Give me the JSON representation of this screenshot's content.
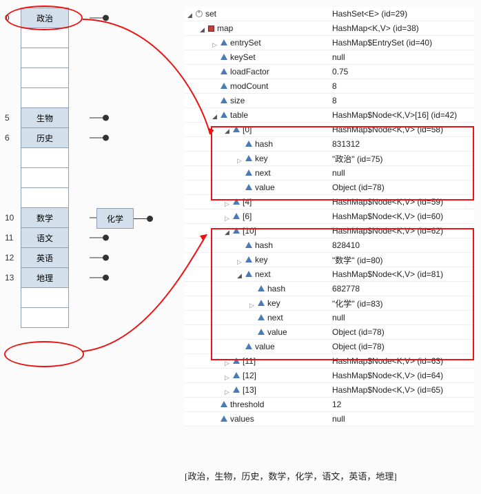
{
  "array": {
    "slots": [
      {
        "idx": "0",
        "label": "政治",
        "filled": true,
        "term": true
      },
      {
        "idx": "",
        "label": "",
        "filled": false
      },
      {
        "idx": "",
        "label": "",
        "filled": false
      },
      {
        "idx": "",
        "label": "",
        "filled": false
      },
      {
        "idx": "",
        "label": "",
        "filled": false
      },
      {
        "idx": "5",
        "label": "生物",
        "filled": true,
        "term": true
      },
      {
        "idx": "6",
        "label": "历史",
        "filled": true,
        "term": true
      },
      {
        "idx": "",
        "label": "",
        "filled": false
      },
      {
        "idx": "",
        "label": "",
        "filled": false
      },
      {
        "idx": "",
        "label": "",
        "filled": false
      },
      {
        "idx": "10",
        "label": "数学",
        "filled": true,
        "arrow": true,
        "chain": "化学"
      },
      {
        "idx": "11",
        "label": "语文",
        "filled": true,
        "term": true
      },
      {
        "idx": "12",
        "label": "英语",
        "filled": true,
        "term": true
      },
      {
        "idx": "13",
        "label": "地理",
        "filled": true,
        "term": true
      },
      {
        "idx": "",
        "label": "",
        "filled": false
      },
      {
        "idx": "",
        "label": "",
        "filled": false
      }
    ]
  },
  "tree": [
    {
      "d": 0,
      "tw": "exp",
      "ic": "circ",
      "n": "set",
      "v": "HashSet<E>  (id=29)"
    },
    {
      "d": 1,
      "tw": "exp",
      "ic": "sq",
      "n": "map",
      "v": "HashMap<K,V>  (id=38)"
    },
    {
      "d": 2,
      "tw": "col",
      "ic": "tri",
      "n": "entrySet",
      "v": "HashMap$EntrySet  (id=40)"
    },
    {
      "d": 2,
      "tw": "none",
      "ic": "tri",
      "n": "keySet",
      "v": "null"
    },
    {
      "d": 2,
      "tw": "none",
      "ic": "triF",
      "n": "loadFactor",
      "v": "0.75"
    },
    {
      "d": 2,
      "tw": "none",
      "ic": "tri",
      "n": "modCount",
      "v": "8"
    },
    {
      "d": 2,
      "tw": "none",
      "ic": "tri",
      "n": "size",
      "v": "8"
    },
    {
      "d": 2,
      "tw": "exp",
      "ic": "tri",
      "n": "table",
      "v": "HashMap$Node<K,V>[16]  (id=42)"
    },
    {
      "d": 3,
      "tw": "exp",
      "ic": "tri",
      "n": "[0]",
      "v": "HashMap$Node<K,V>  (id=58)"
    },
    {
      "d": 4,
      "tw": "none",
      "ic": "triF",
      "n": "hash",
      "v": "831312"
    },
    {
      "d": 4,
      "tw": "col",
      "ic": "tri",
      "n": "key",
      "v": "\"政治\" (id=75)"
    },
    {
      "d": 4,
      "tw": "none",
      "ic": "tri",
      "n": "next",
      "v": "null"
    },
    {
      "d": 4,
      "tw": "none",
      "ic": "tri",
      "n": "value",
      "v": "Object  (id=78)"
    },
    {
      "d": 3,
      "tw": "col",
      "ic": "tri",
      "n": "[4]",
      "v": "HashMap$Node<K,V>  (id=59)"
    },
    {
      "d": 3,
      "tw": "col",
      "ic": "tri",
      "n": "[6]",
      "v": "HashMap$Node<K,V>  (id=60)"
    },
    {
      "d": 3,
      "tw": "exp",
      "ic": "tri",
      "n": "[10]",
      "v": "HashMap$Node<K,V>  (id=62)"
    },
    {
      "d": 4,
      "tw": "none",
      "ic": "triF",
      "n": "hash",
      "v": "828410"
    },
    {
      "d": 4,
      "tw": "col",
      "ic": "tri",
      "n": "key",
      "v": "\"数学\" (id=80)"
    },
    {
      "d": 4,
      "tw": "exp",
      "ic": "tri",
      "n": "next",
      "v": "HashMap$Node<K,V>  (id=81)"
    },
    {
      "d": 5,
      "tw": "none",
      "ic": "triF",
      "n": "hash",
      "v": "682778"
    },
    {
      "d": 5,
      "tw": "col",
      "ic": "tri",
      "n": "key",
      "v": "\"化学\" (id=83)"
    },
    {
      "d": 5,
      "tw": "none",
      "ic": "tri",
      "n": "next",
      "v": "null"
    },
    {
      "d": 5,
      "tw": "none",
      "ic": "tri",
      "n": "value",
      "v": "Object  (id=78)"
    },
    {
      "d": 4,
      "tw": "none",
      "ic": "tri",
      "n": "value",
      "v": "Object  (id=78)"
    },
    {
      "d": 3,
      "tw": "col",
      "ic": "tri",
      "n": "[11]",
      "v": "HashMap$Node<K,V>  (id=63)"
    },
    {
      "d": 3,
      "tw": "col",
      "ic": "tri",
      "n": "[12]",
      "v": "HashMap$Node<K,V>  (id=64)"
    },
    {
      "d": 3,
      "tw": "col",
      "ic": "tri",
      "n": "[13]",
      "v": "HashMap$Node<K,V>  (id=65)"
    },
    {
      "d": 2,
      "tw": "none",
      "ic": "tri",
      "n": "threshold",
      "v": "12"
    },
    {
      "d": 2,
      "tw": "none",
      "ic": "tri",
      "n": "values",
      "v": "null"
    }
  ],
  "footer": "[政治，生物，历史，数学，化学，语文，英语，地理]"
}
